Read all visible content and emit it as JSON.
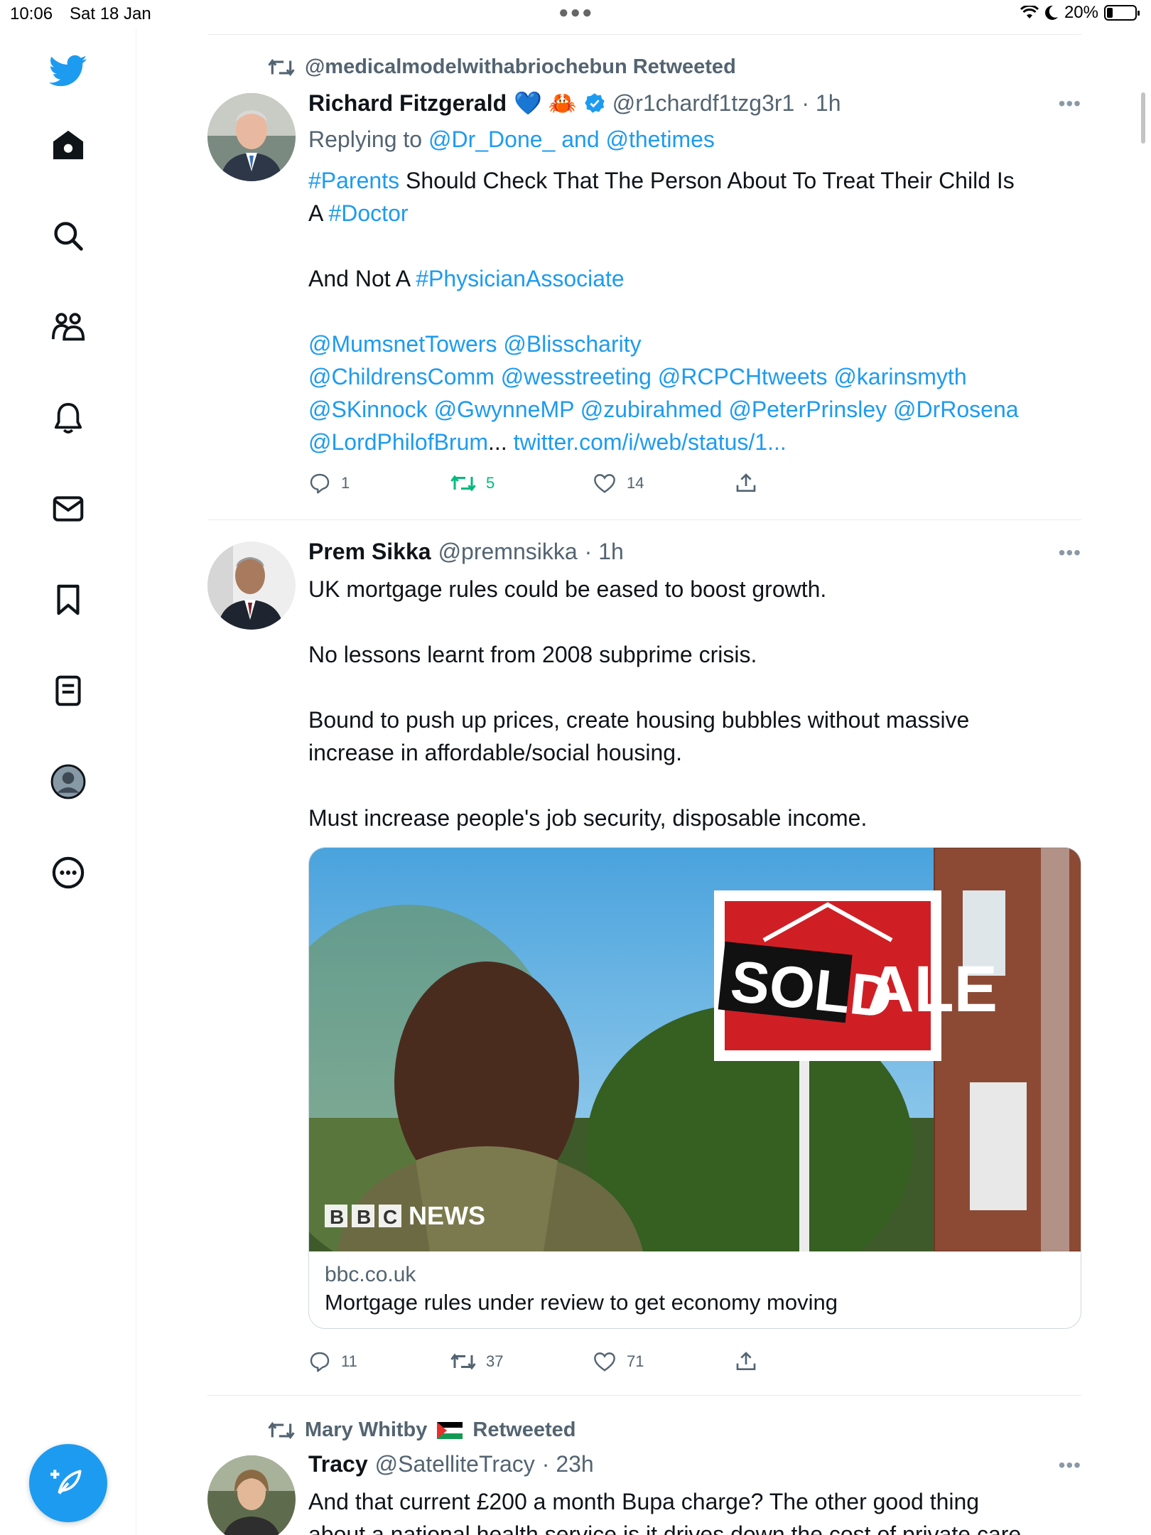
{
  "status_bar": {
    "time": "10:06",
    "date": "Sat 18 Jan",
    "battery": "20%",
    "battery_level": 0.2
  },
  "sidebar": {
    "items": [
      {
        "name": "twitter-logo-icon"
      },
      {
        "name": "home-icon"
      },
      {
        "name": "search-icon"
      },
      {
        "name": "communities-icon"
      },
      {
        "name": "notifications-bell-icon"
      },
      {
        "name": "messages-envelope-icon"
      },
      {
        "name": "bookmark-icon"
      },
      {
        "name": "lists-icon"
      },
      {
        "name": "profile-avatar-icon"
      },
      {
        "name": "more-circle-icon"
      }
    ],
    "compose": "compose-tweet-icon"
  },
  "tweets": [
    {
      "retweeted_by": "@medicalmodelwithabriochebun Retweeted",
      "name": "Richard Fitzgerald",
      "emojis": "💙 🦀",
      "verified": true,
      "handle": "@r1chardf1tzg3r1",
      "time": "· 1h",
      "reply_prefix": "Replying to",
      "reply_to": "@Dr_Done_ and @thetimes",
      "line1_tag": "#Parents",
      "line1_text": " Should Check That The Person  About To Treat Their Child Is",
      "line2_text": "A ",
      "line2_tag": "#Doctor",
      "line3_text": "And Not A ",
      "line3_tag": "#PhysicianAssociate",
      "mentions_1": "@MumsnetTowers @Blisscharity",
      "mentions_2": "@ChildrensComm @wesstreeting @RCPCHtweets @karinsmyth",
      "mentions_3": "@SKinnock @GwynneMP @zubirahmed @PeterPrinsley @DrRosena",
      "mentions_4": "@LordPhilofBrum",
      "ellipsis": "...",
      "url": "twitter.com/i/web/status/1...",
      "replies": "1",
      "retweets": "5",
      "likes": "14"
    },
    {
      "name": "Prem Sikka",
      "handle": "@premnsikka",
      "time": "· 1h",
      "p1": "UK mortgage rules could be eased to boost growth.",
      "p2": "No lessons learnt from 2008 subprime crisis.",
      "p3a": "Bound to push up prices, create housing bubbles without massive",
      "p3b": "increase in affordable/social housing.",
      "p4": "Must increase people's job security, disposable income.",
      "card": {
        "image_sign_text": "SOLD",
        "image_sign_behind": "ALE",
        "image_brand": "NEWS",
        "image_brand_letters": [
          "B",
          "B",
          "C"
        ],
        "domain": "bbc.co.uk",
        "title": "Mortgage rules under review to get economy moving"
      },
      "replies": "11",
      "retweets": "37",
      "likes": "71"
    },
    {
      "retweeted_by_name": "Mary Whitby",
      "retweeted_suffix": "Retweeted",
      "name": "Tracy",
      "handle": "@SatelliteTracy",
      "time": "· 23h",
      "line1": "And that current £200 a month Bupa charge? The other good thing",
      "line2": "about a national health service is it drives down the cost of private care"
    }
  ],
  "colors": {
    "accent": "#1d9bf0",
    "retweet_active": "#00ba7c",
    "muted": "#536471"
  }
}
